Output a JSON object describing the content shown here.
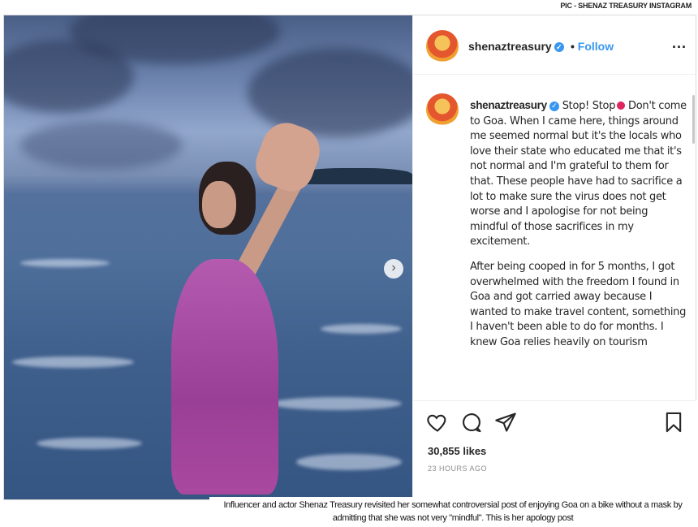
{
  "credit": "PIC - SHENAZ TREASURY INSTAGRAM",
  "post": {
    "username": "shenaztreasury",
    "follow_separator": "•",
    "follow_label": "Follow",
    "more_label": "...",
    "caption_username": "shenaztreasury",
    "caption_paragraphs": [
      "Stop! Stop",
      "Don't come to Goa. When I came here, things around me seemed normal but it's the locals who love their state who educated me that it's not normal and I'm grateful to them for that. These people have had to sacrifice a lot to make sure the virus does not get worse and I apologise for not being mindful of those sacrifices in my excitement.",
      "After being cooped in for 5 months, I got overwhelmed with the freedom I found in Goa and got carried away because I wanted to make travel content, something I haven't been able to do for months. I knew Goa relies heavily on tourism"
    ],
    "likes": "30,855 likes",
    "time": "23 HOURS AGO",
    "icons": {
      "like": "heart-icon",
      "comment": "comment-icon",
      "share": "send-icon",
      "save": "bookmark-icon",
      "verified": "verified-badge-icon",
      "next": "chevron-right-icon"
    },
    "colors": {
      "link": "#3897f0",
      "verified": "#3897f0",
      "dress": "#9a3f96"
    }
  },
  "photo_caption": "Influencer and actor Shenaz Treasury revisited her somewhat controversial post of enjoying Goa on a bike without a mask by admitting that she was not very \"mindful\". This is her apology post"
}
